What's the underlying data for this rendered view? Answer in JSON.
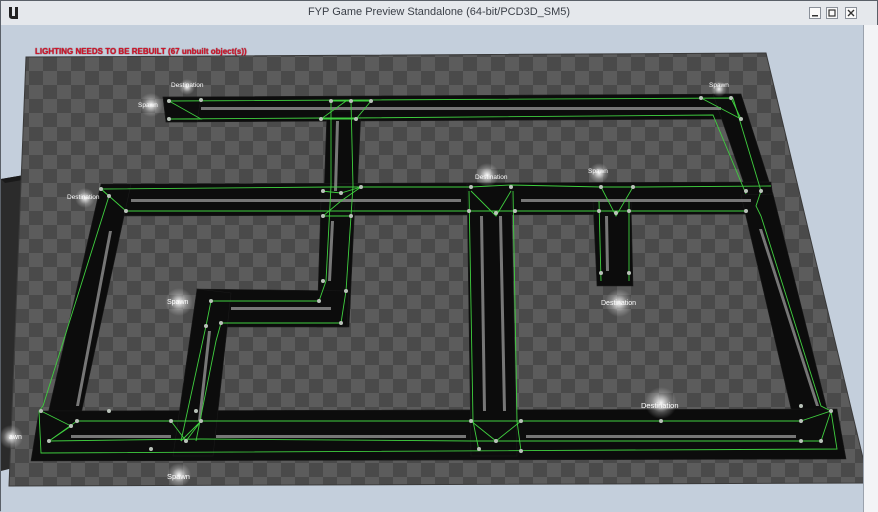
{
  "window": {
    "title": "FYP Game Preview Standalone (64-bit/PCD3D_SM5)"
  },
  "viewport": {
    "warning": "LIGHTING NEEDS TO BE REBUILT (67 unbuilt object(s))",
    "markers": {
      "destination_top_left": "Destination",
      "spawn_top_left": "Spawn",
      "spawn_top_right": "Spawn",
      "destination_left": "Destination",
      "destination_center": "Destination",
      "spawn_upper_right": "Spawn",
      "spawn_mid_left": "Spawn",
      "destination_mid_right": "Destination",
      "destination_lower_right": "Destination",
      "spawn_bottom": "Spawn",
      "spawn_edge_left": "awn"
    }
  },
  "colors": {
    "navmesh_line": "#3fcf3f",
    "road": "#0c0c0c",
    "floor_light": "#5a5a5a",
    "floor_dark": "#444444",
    "warning": "#d3132b"
  },
  "icons": {
    "app_logo": "unreal-engine-logo",
    "minimize": "minimize-icon",
    "maximize": "maximize-icon",
    "close": "close-icon"
  }
}
